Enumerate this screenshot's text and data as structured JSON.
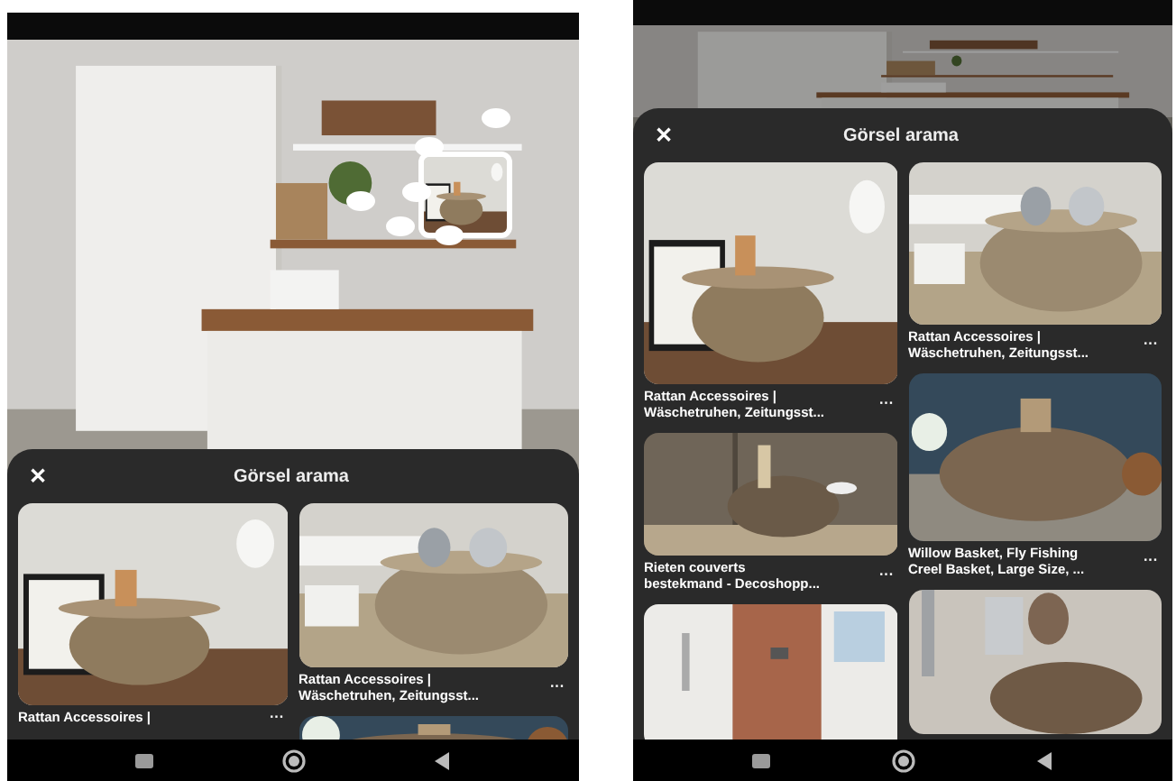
{
  "screens": [
    {
      "sheet": {
        "close": "✕",
        "title": "Görsel arama"
      },
      "columns": [
        [
          {
            "kind": "result",
            "caption": [
              "Rattan Accessoires |"
            ],
            "menu": "···"
          }
        ],
        [
          {
            "kind": "result",
            "caption": [
              "Rattan Accessoires |",
              "Wäschetruhen, Zeitungsst..."
            ],
            "menu": "···"
          },
          {
            "kind": "picture"
          }
        ]
      ]
    },
    {
      "sheet": {
        "close": "✕",
        "title": "Görsel arama"
      },
      "columns": [
        [
          {
            "kind": "result",
            "caption": [
              "Rattan Accessoires |",
              "Wäschetruhen, Zeitungsst..."
            ],
            "menu": "···"
          },
          {
            "kind": "result",
            "caption": [
              "Rieten couverts",
              "bestekmand - Decoshopp..."
            ],
            "menu": "···"
          },
          {
            "kind": "picture"
          }
        ],
        [
          {
            "kind": "result",
            "caption": [
              "Rattan Accessoires |",
              "Wäschetruhen, Zeitungsst..."
            ],
            "menu": "···"
          },
          {
            "kind": "result",
            "caption": [
              "Willow Basket, Fly Fishing",
              "Creel Basket, Large Size, ..."
            ],
            "menu": "···"
          },
          {
            "kind": "picture"
          }
        ]
      ]
    }
  ]
}
